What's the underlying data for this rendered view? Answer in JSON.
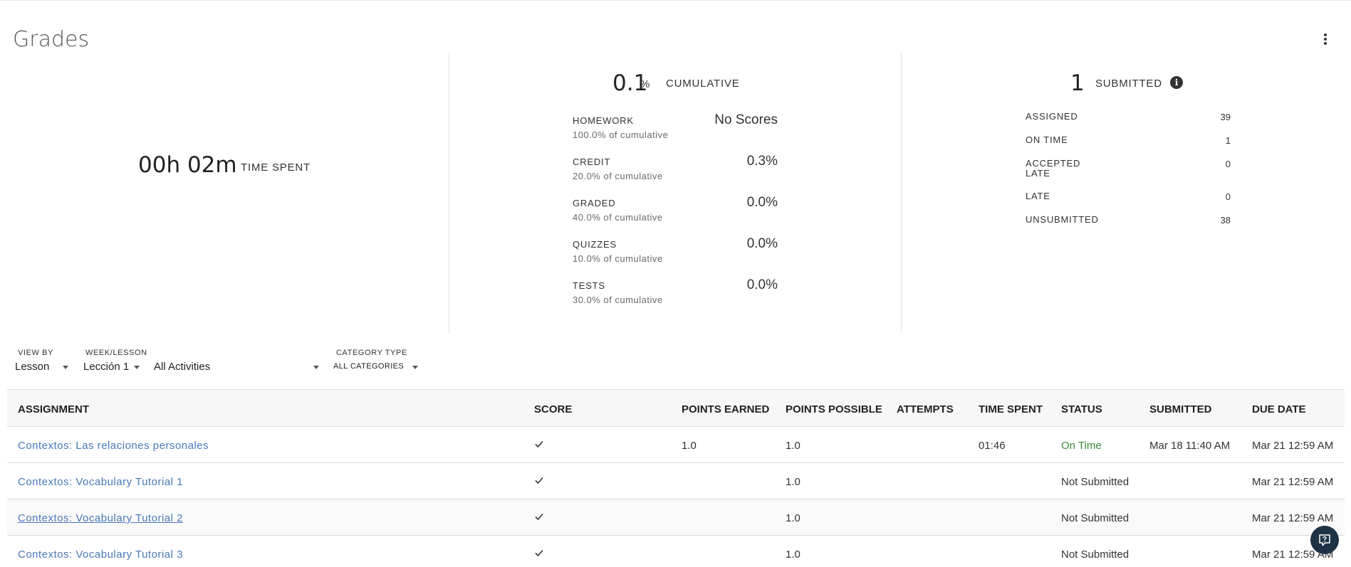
{
  "page": {
    "title": "Grades"
  },
  "time_spent": {
    "value": "00h 02m",
    "label": "TIME SPENT"
  },
  "cumulative": {
    "value": "0.1",
    "unit": "%",
    "label": "CUMULATIVE",
    "categories": [
      {
        "name": "HOMEWORK",
        "weight": "100.0% of cumulative",
        "score": "No Scores"
      },
      {
        "name": "CREDIT",
        "weight": "20.0% of cumulative",
        "score": "0.3%"
      },
      {
        "name": "GRADED",
        "weight": "40.0% of cumulative",
        "score": "0.0%"
      },
      {
        "name": "QUIZZES",
        "weight": "10.0% of cumulative",
        "score": "0.0%"
      },
      {
        "name": "TESTS",
        "weight": "30.0% of cumulative",
        "score": "0.0%"
      }
    ]
  },
  "submitted": {
    "value": "1",
    "label": "SUBMITTED",
    "info_icon": "info-icon",
    "rows": [
      {
        "label": "ASSIGNED",
        "value": "39"
      },
      {
        "label": "ON TIME",
        "value": "1"
      },
      {
        "label": "ACCEPTED LATE",
        "value": "0"
      },
      {
        "label": "LATE",
        "value": "0"
      },
      {
        "label": "UNSUBMITTED",
        "value": "38"
      }
    ]
  },
  "filters": {
    "view_by": {
      "label": "VIEW BY",
      "value": "Lesson"
    },
    "week_lesson": {
      "label": "WEEK/LESSON",
      "value": "Lección 1"
    },
    "activities": {
      "value": "All Activities"
    },
    "category_type": {
      "label": "CATEGORY TYPE",
      "value": "ALL CATEGORIES"
    }
  },
  "table": {
    "headers": {
      "assignment": "ASSIGNMENT",
      "score": "SCORE",
      "points_earned": "POINTS EARNED",
      "points_possible": "POINTS POSSIBLE",
      "attempts": "ATTEMPTS",
      "time_spent": "TIME SPENT",
      "status": "STATUS",
      "submitted": "SUBMITTED",
      "due_date": "DUE DATE"
    },
    "rows": [
      {
        "assignment": "Contextos: Las relaciones personales",
        "score_icon": "check-icon",
        "points_earned": "1.0",
        "points_possible": "1.0",
        "attempts": "",
        "time_spent": "01:46",
        "status": "On Time",
        "submitted": "Mar 18 11:40 AM",
        "due_date": "Mar 21 12:59 AM"
      },
      {
        "assignment": "Contextos: Vocabulary Tutorial 1",
        "score_icon": "check-icon",
        "points_earned": "",
        "points_possible": "1.0",
        "attempts": "",
        "time_spent": "",
        "status": "Not Submitted",
        "submitted": "",
        "due_date": "Mar 21 12:59 AM"
      },
      {
        "assignment": "Contextos: Vocabulary Tutorial 2",
        "score_icon": "check-icon",
        "points_earned": "",
        "points_possible": "1.0",
        "attempts": "",
        "time_spent": "",
        "status": "Not Submitted",
        "submitted": "",
        "due_date": "Mar 21 12:59 AM"
      },
      {
        "assignment": "Contextos: Vocabulary Tutorial 3",
        "score_icon": "check-icon",
        "points_earned": "",
        "points_possible": "1.0",
        "attempts": "",
        "time_spent": "",
        "status": "Not Submitted",
        "submitted": "",
        "due_date": "Mar 21 12:59 AM"
      }
    ]
  },
  "colors": {
    "link": "#4a78b8",
    "on_time": "#3b8a3b",
    "help_button": "#1e3446"
  }
}
